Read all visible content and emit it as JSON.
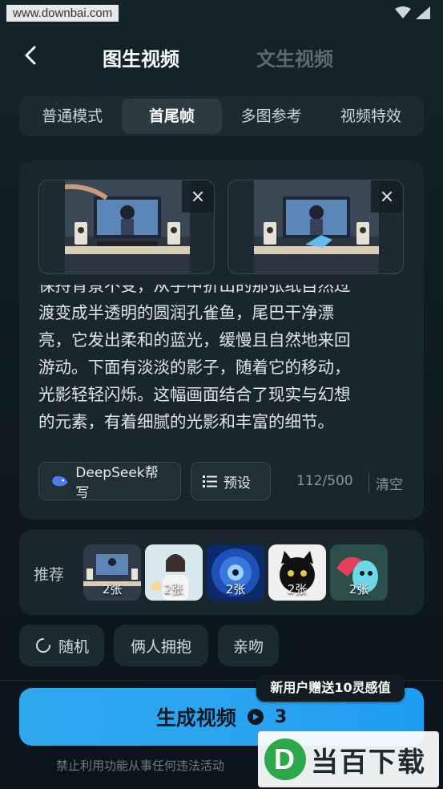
{
  "overlay": {
    "watermark_url": "www.downbai.com",
    "logo_text": "当百下载",
    "logo_letter": "D"
  },
  "header": {
    "tabs": [
      "图生视频",
      "文生视频"
    ],
    "active_tab": "图生视频"
  },
  "modes": [
    "普通模式",
    "首尾帧",
    "多图参考",
    "视频特效"
  ],
  "active_mode": "首尾帧",
  "frames": [
    {
      "name": "first-frame",
      "close_icon": "close-icon"
    },
    {
      "name": "last-frame",
      "close_icon": "close-icon"
    }
  ],
  "prompt": {
    "lines": [
      "保持背景不变，从手中折出的那张纸自然过",
      "渡变成半透明的圆润孔雀鱼，尾巴干净漂",
      "亮，它发出柔和的蓝光，缓慢且自然地来回",
      "游动。下面有淡淡的影子，随着它的移动，",
      "光影轻轻闪烁。这幅画面结合了现实与幻想",
      "的元素，有着细腻的光影和丰富的细节。"
    ]
  },
  "tools": {
    "deepseek_label": "DeepSeek帮写",
    "preset_label": "预设",
    "counter": "112/500",
    "clear_label": "清空"
  },
  "recommend": {
    "label": "推荐",
    "items": [
      {
        "count": "2张"
      },
      {
        "count": "2张"
      },
      {
        "count": "2张"
      },
      {
        "count": "2张"
      },
      {
        "count": "2张"
      }
    ]
  },
  "chips": [
    "随机",
    "俩人拥抱",
    "亲吻"
  ],
  "generate": {
    "label": "生成视频",
    "cost": "3",
    "promo": "新用户赠送10灵感值"
  },
  "disclaimer": "禁止利用功能从事任何违法活动",
  "colors": {
    "accent": "#2aa3f2",
    "background": "#0f1b22",
    "card": "#1a262d"
  }
}
